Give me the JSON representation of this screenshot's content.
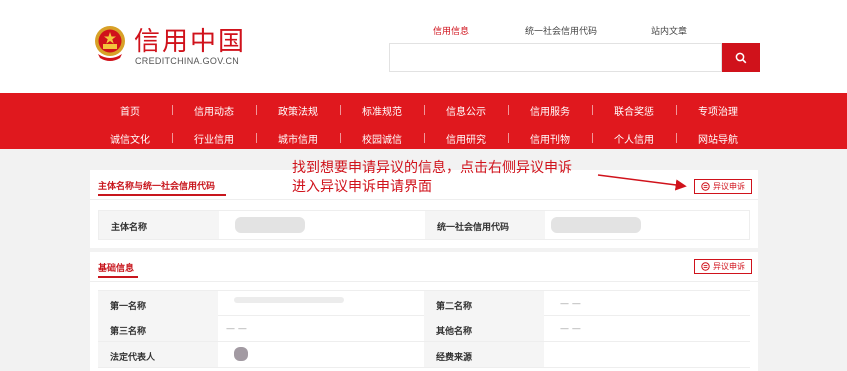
{
  "header": {
    "logo_title": "信用中国",
    "logo_subtitle": "CREDITCHINA.GOV.CN",
    "search_tabs": [
      "信用信息",
      "统一社会信用代码",
      "站内文章"
    ],
    "active_tab": "信用信息",
    "search_placeholder": "",
    "search_icon": "search-icon"
  },
  "nav": {
    "row1": [
      "首页",
      "信用动态",
      "政策法规",
      "标准规范",
      "信息公示",
      "信用服务",
      "联合奖惩",
      "专项治理"
    ],
    "row2": [
      "诚信文化",
      "行业信用",
      "城市信用",
      "校园诚信",
      "信用研究",
      "信用刊物",
      "个人信用",
      "网站导航"
    ]
  },
  "annotation": {
    "line1": "找到想要申请异议的信息，点击右侧异议申诉",
    "line2": "进入异议申诉申请界面"
  },
  "card1": {
    "title": "主体名称与统一社会信用代码",
    "appeal_label": "异议申诉",
    "fields": [
      {
        "label": "主体名称",
        "value": ""
      },
      {
        "label": "统一社会信用代码",
        "value": ""
      }
    ]
  },
  "card2": {
    "title": "基础信息",
    "appeal_label": "异议申诉",
    "rows": [
      {
        "label_left": "第一名称",
        "value_left": "",
        "label_right": "第二名称",
        "value_right": "— —"
      },
      {
        "label_left": "第三名称",
        "value_left": "— —",
        "label_right": "其他名称",
        "value_right": "— —"
      },
      {
        "label_left": "法定代表人",
        "value_left": "",
        "label_right": "经费来源",
        "value_right": ""
      }
    ]
  },
  "colors": {
    "brand_red": "#e0181e",
    "accent_red": "#d0121b"
  }
}
